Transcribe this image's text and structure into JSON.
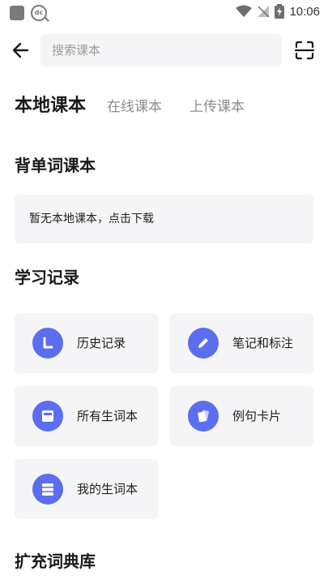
{
  "status_bar": {
    "time": "10:06"
  },
  "header": {
    "search_placeholder": "搜索课本"
  },
  "tabs": [
    {
      "label": "本地课本",
      "active": true
    },
    {
      "label": "在线课本",
      "active": false
    },
    {
      "label": "上传课本",
      "active": false
    }
  ],
  "sections": {
    "vocab_books": {
      "title": "背单词课本",
      "empty_text": "暂无本地课本，点击下载"
    },
    "study_records": {
      "title": "学习记录",
      "items": [
        {
          "label": "历史记录",
          "icon": "history-icon"
        },
        {
          "label": "笔记和标注",
          "icon": "pencil-icon"
        },
        {
          "label": "所有生词本",
          "icon": "card-list-icon"
        },
        {
          "label": "例句卡片",
          "icon": "cards-icon"
        },
        {
          "label": "我的生词本",
          "icon": "list-icon"
        }
      ]
    },
    "dictionaries": {
      "title": "扩充词典库"
    }
  },
  "colors": {
    "accent": "#5b6ef0",
    "card_bg": "#f5f5f7"
  }
}
